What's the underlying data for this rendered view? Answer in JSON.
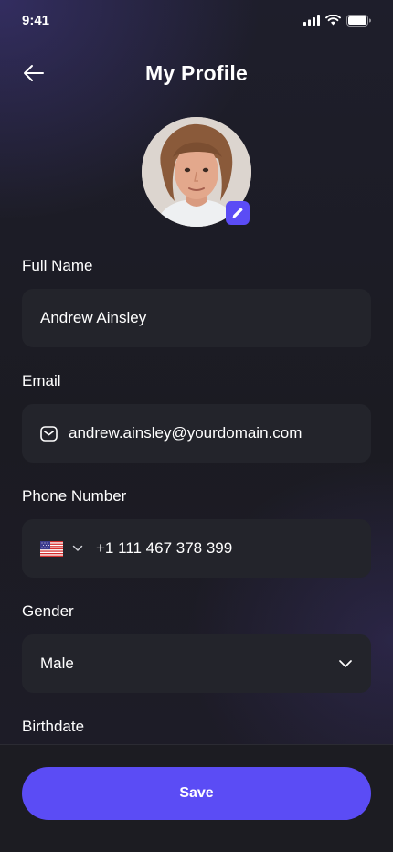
{
  "status_bar": {
    "time": "9:41"
  },
  "header": {
    "title": "My Profile"
  },
  "form": {
    "full_name": {
      "label": "Full Name",
      "value": "Andrew Ainsley"
    },
    "email": {
      "label": "Email",
      "value": "andrew.ainsley@yourdomain.com"
    },
    "phone": {
      "label": "Phone Number",
      "value": "+1 111 467 378 399",
      "country_flag": "us-flag-icon"
    },
    "gender": {
      "label": "Gender",
      "value": "Male"
    },
    "birthdate": {
      "label": "Birthdate"
    }
  },
  "actions": {
    "save_label": "Save"
  },
  "colors": {
    "accent": "#5B4CF5",
    "field_bg": "#23242B",
    "background": "#191A1F"
  }
}
